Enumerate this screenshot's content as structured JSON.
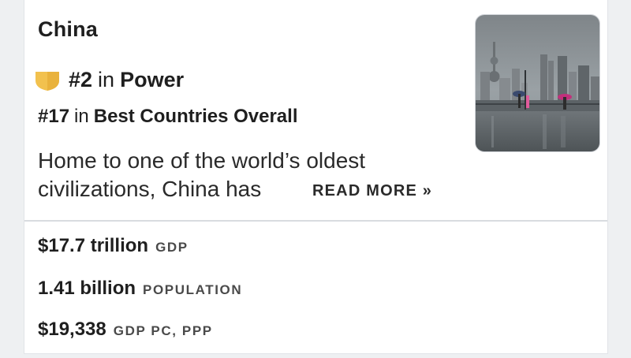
{
  "country": {
    "name": "China"
  },
  "power_rank": {
    "rank": "#2",
    "in": "in",
    "category": "Power",
    "badge_color": "#f2c14e"
  },
  "overall_rank": {
    "rank": "#17",
    "in": "in",
    "category": "Best Countries Overall"
  },
  "description": {
    "line1": "Home to one of the world’s oldest",
    "line2": "civilizations, China has"
  },
  "read_more": {
    "label": "READ MORE »"
  },
  "image": {
    "icon": "city-skyline-photo"
  },
  "stats": [
    {
      "value": "$17.7 trillion",
      "label": "GDP"
    },
    {
      "value": "1.41 billion",
      "label": "POPULATION"
    },
    {
      "value": "$19,338",
      "label": "GDP PC, PPP"
    }
  ]
}
